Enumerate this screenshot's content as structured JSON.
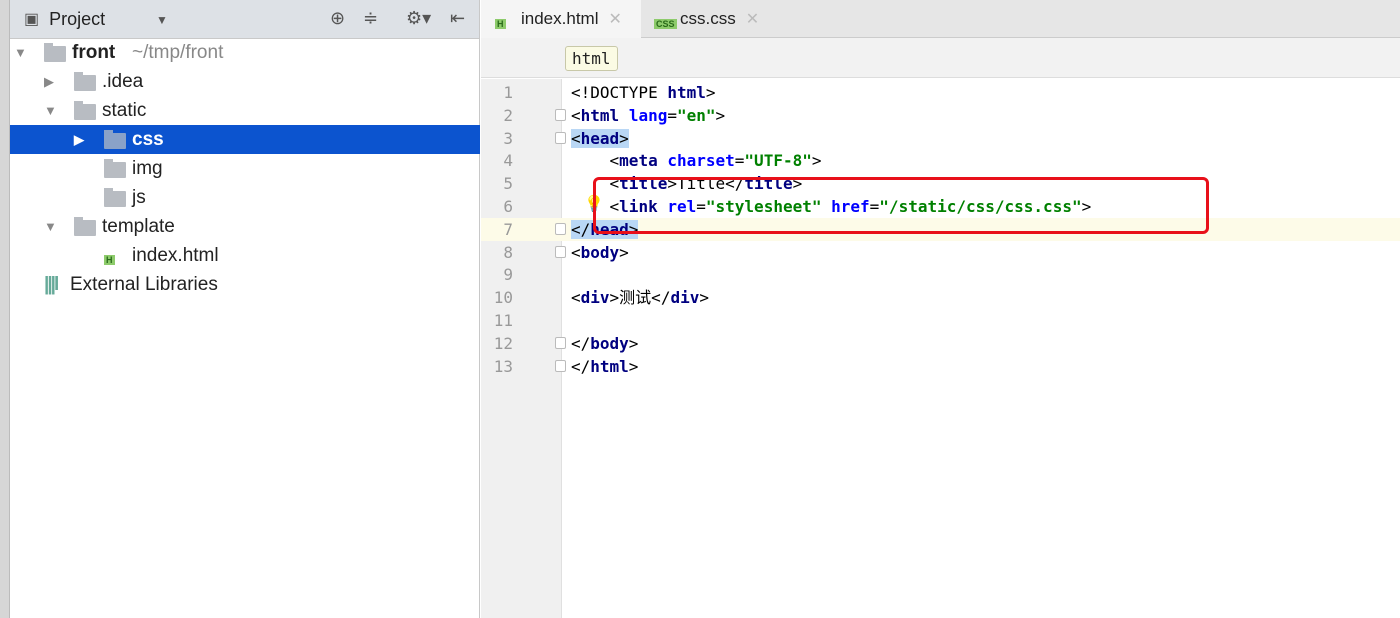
{
  "project_panel": {
    "title": "Project",
    "icons": [
      "locate-icon",
      "collapse-icon",
      "gear-icon",
      "hide-panel-icon"
    ],
    "tree": [
      {
        "label": "front",
        "suffix": "~/tmp/front",
        "depth": 0,
        "type": "module",
        "expanded": true
      },
      {
        "label": ".idea",
        "depth": 1,
        "type": "folder",
        "expanded": false
      },
      {
        "label": "static",
        "depth": 1,
        "type": "folder",
        "expanded": true
      },
      {
        "label": "css",
        "depth": 2,
        "type": "folder",
        "expanded": false,
        "selected": true
      },
      {
        "label": "img",
        "depth": 2,
        "type": "folder"
      },
      {
        "label": "js",
        "depth": 2,
        "type": "folder"
      },
      {
        "label": "template",
        "depth": 1,
        "type": "folder",
        "expanded": true
      },
      {
        "label": "index.html",
        "depth": 2,
        "type": "html"
      },
      {
        "label": "External Libraries",
        "depth": 0,
        "type": "library"
      }
    ]
  },
  "editor": {
    "tabs": [
      {
        "label": "index.html",
        "badge": "H",
        "active": true
      },
      {
        "label": "css.css",
        "badge": "CSS",
        "active": false
      }
    ],
    "breadcrumb": "html",
    "current_line": 7,
    "lines": [
      [
        {
          "t": "plain",
          "s": "<!DOCTYPE "
        },
        {
          "t": "tag",
          "s": "html"
        },
        {
          "t": "plain",
          "s": ">"
        }
      ],
      [
        {
          "t": "plain",
          "s": "<"
        },
        {
          "t": "tag",
          "s": "html "
        },
        {
          "t": "attr",
          "s": "lang"
        },
        {
          "t": "plain",
          "s": "="
        },
        {
          "t": "val",
          "s": "\"en\""
        },
        {
          "t": "plain",
          "s": ">"
        }
      ],
      [
        {
          "t": "plain",
          "s": "<",
          "h": 1
        },
        {
          "t": "tag",
          "s": "head",
          "h": 1
        },
        {
          "t": "plain",
          "s": ">",
          "h": 1
        }
      ],
      [
        {
          "t": "plain",
          "s": "    <"
        },
        {
          "t": "tag",
          "s": "meta "
        },
        {
          "t": "attr",
          "s": "charset"
        },
        {
          "t": "plain",
          "s": "="
        },
        {
          "t": "val",
          "s": "\"UTF-8\""
        },
        {
          "t": "plain",
          "s": ">"
        }
      ],
      [
        {
          "t": "plain",
          "s": "    <"
        },
        {
          "t": "tag",
          "s": "title"
        },
        {
          "t": "plain",
          "s": ">Title</"
        },
        {
          "t": "tag",
          "s": "title"
        },
        {
          "t": "plain",
          "s": ">"
        }
      ],
      [
        {
          "t": "plain",
          "s": "    <"
        },
        {
          "t": "tag",
          "s": "link "
        },
        {
          "t": "attr",
          "s": "rel"
        },
        {
          "t": "plain",
          "s": "="
        },
        {
          "t": "val",
          "s": "\"stylesheet\" "
        },
        {
          "t": "attr",
          "s": "href"
        },
        {
          "t": "plain",
          "s": "="
        },
        {
          "t": "val",
          "s": "\"/static/css/css.css\""
        },
        {
          "t": "plain",
          "s": ">"
        }
      ],
      [
        {
          "t": "plain",
          "s": "</",
          "h": 1
        },
        {
          "t": "tag",
          "s": "head",
          "h": 1
        },
        {
          "t": "plain",
          "s": ">",
          "h": 1
        }
      ],
      [
        {
          "t": "plain",
          "s": "<"
        },
        {
          "t": "tag",
          "s": "body"
        },
        {
          "t": "plain",
          "s": ">"
        }
      ],
      [],
      [
        {
          "t": "plain",
          "s": "<"
        },
        {
          "t": "tag",
          "s": "div"
        },
        {
          "t": "plain",
          "s": ">测试</"
        },
        {
          "t": "tag",
          "s": "div"
        },
        {
          "t": "plain",
          "s": ">"
        }
      ],
      [],
      [
        {
          "t": "plain",
          "s": "</"
        },
        {
          "t": "tag",
          "s": "body"
        },
        {
          "t": "plain",
          "s": ">"
        }
      ],
      [
        {
          "t": "plain",
          "s": "</"
        },
        {
          "t": "tag",
          "s": "html"
        },
        {
          "t": "plain",
          "s": ">"
        }
      ]
    ],
    "fold_lines": [
      2,
      3,
      7,
      8,
      12,
      13
    ],
    "annotation_color": "#e8101a"
  }
}
